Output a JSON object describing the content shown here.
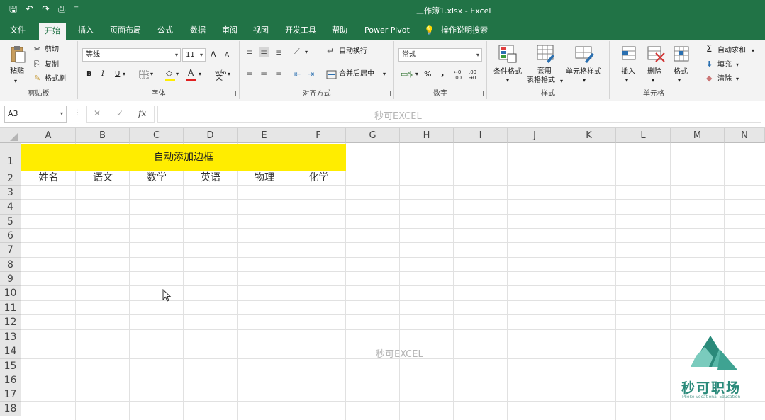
{
  "titlebar": {
    "qat": {
      "save": "🖫",
      "undo": "↶",
      "redo": "↷",
      "preview": "⎙",
      "customize": "⁼"
    },
    "title": "工作簿1.xlsx  -  Excel"
  },
  "tabs": [
    "文件",
    "开始",
    "插入",
    "页面布局",
    "公式",
    "数据",
    "审阅",
    "视图",
    "开发工具",
    "帮助",
    "Power Pivot",
    "操作说明搜索"
  ],
  "active_tab": "开始",
  "ribbon": {
    "clipboard": {
      "label": "剪贴板",
      "paste": "粘贴",
      "cut": "剪切",
      "copy": "复制",
      "format_painter": "格式刷"
    },
    "font": {
      "label": "字体",
      "font_name": "等线",
      "font_size": "11",
      "bold": "B",
      "italic": "I",
      "underline": "U",
      "grow": "A",
      "shrink": "A",
      "font_color": "A",
      "phonetic": "wén"
    },
    "alignment": {
      "label": "对齐方式",
      "wrap": "自动换行",
      "merge": "合并后居中"
    },
    "number": {
      "label": "数字",
      "format": "常规",
      "percent": "%",
      "comma": ",",
      "inc_dec": "←0\n.00",
      "dec_dec": ".00\n→0"
    },
    "styles": {
      "label": "样式",
      "conditional": "条件格式",
      "table_format_1": "套用",
      "table_format_2": "表格格式",
      "cell_styles": "单元格样式"
    },
    "cells": {
      "label": "单元格",
      "insert": "插入",
      "delete": "删除",
      "format": "格式"
    },
    "editing": {
      "autosum": "自动求和",
      "fill": "填充",
      "clear": "清除"
    }
  },
  "formula_bar": {
    "name_box": "A3",
    "cancel": "✕",
    "enter": "✓",
    "fx": "fx",
    "content": ""
  },
  "columns": [
    "A",
    "B",
    "C",
    "D",
    "E",
    "F",
    "G",
    "H",
    "I",
    "J",
    "K",
    "L",
    "M",
    "N"
  ],
  "rows": [
    "1",
    "2",
    "3",
    "4",
    "5",
    "6",
    "7",
    "8",
    "9",
    "10",
    "11",
    "12",
    "13",
    "14",
    "15",
    "16",
    "17",
    "18"
  ],
  "cells": {
    "merged_title": "自动添加边框",
    "headers": [
      "姓名",
      "语文",
      "数学",
      "英语",
      "物理",
      "化学"
    ]
  },
  "watermarks": {
    "top": "秒可EXCEL",
    "middle": "秒可EXCEL"
  },
  "logo": {
    "name": "秒可职场",
    "sub": "Mioke vocational Education"
  },
  "colors": {
    "accent": "#217346",
    "highlight": "#ffed00",
    "logo": "#2a8a7a"
  }
}
